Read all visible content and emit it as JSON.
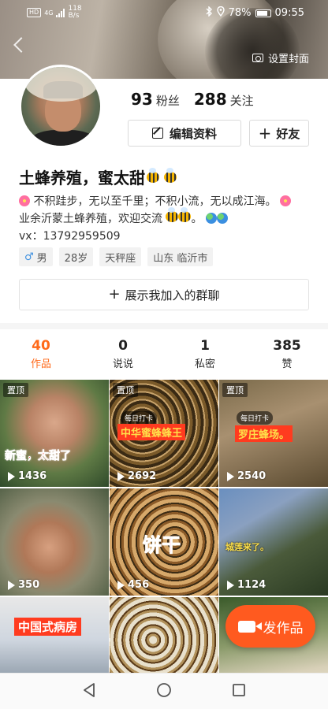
{
  "status_bar": {
    "network_label": "HD",
    "network_gen": "4G",
    "speed": "118",
    "speed_unit": "B/s",
    "battery": "78%",
    "time": "09:55"
  },
  "cover": {
    "set_cover_label": "设置封面"
  },
  "profile": {
    "fans_count": "93",
    "fans_label": "粉丝",
    "following_count": "288",
    "following_label": "关注",
    "edit_label": "编辑资料",
    "friend_label": "好友",
    "name": "土蜂养殖，蜜太甜",
    "bio_line1": "不积跬步，无以至千里；不积小流，无以成江海。",
    "bio_line2": "业余沂蒙土蜂养殖，欢迎交流",
    "vx": "vx：13792959509",
    "tags": {
      "gender": "男",
      "age": "28岁",
      "zodiac": "天秤座",
      "location": "山东 临沂市"
    },
    "group_label": "展示我加入的群聊"
  },
  "tabs": [
    {
      "count": "40",
      "label": "作品"
    },
    {
      "count": "0",
      "label": "说说"
    },
    {
      "count": "1",
      "label": "私密"
    },
    {
      "count": "385",
      "label": "赞"
    }
  ],
  "videos": [
    {
      "pinned": "置顶",
      "views": "1436",
      "caption": "新蜜，太甜了"
    },
    {
      "pinned": "置顶",
      "views": "2692",
      "daily": "每日打卡",
      "caption": "中华蜜蜂蜂王"
    },
    {
      "pinned": "置顶",
      "views": "2540",
      "daily": "每日打卡",
      "caption": "罗庄蜂场。"
    },
    {
      "views": "350"
    },
    {
      "views": "456",
      "caption": "饼干"
    },
    {
      "views": "1124",
      "caption": "城莲来了。"
    },
    {
      "caption": "中国式病房"
    },
    {},
    {}
  ],
  "post_button_label": "发作品",
  "colors": {
    "accent": "#ff6a1a",
    "post_button": "#ff5a1f"
  }
}
